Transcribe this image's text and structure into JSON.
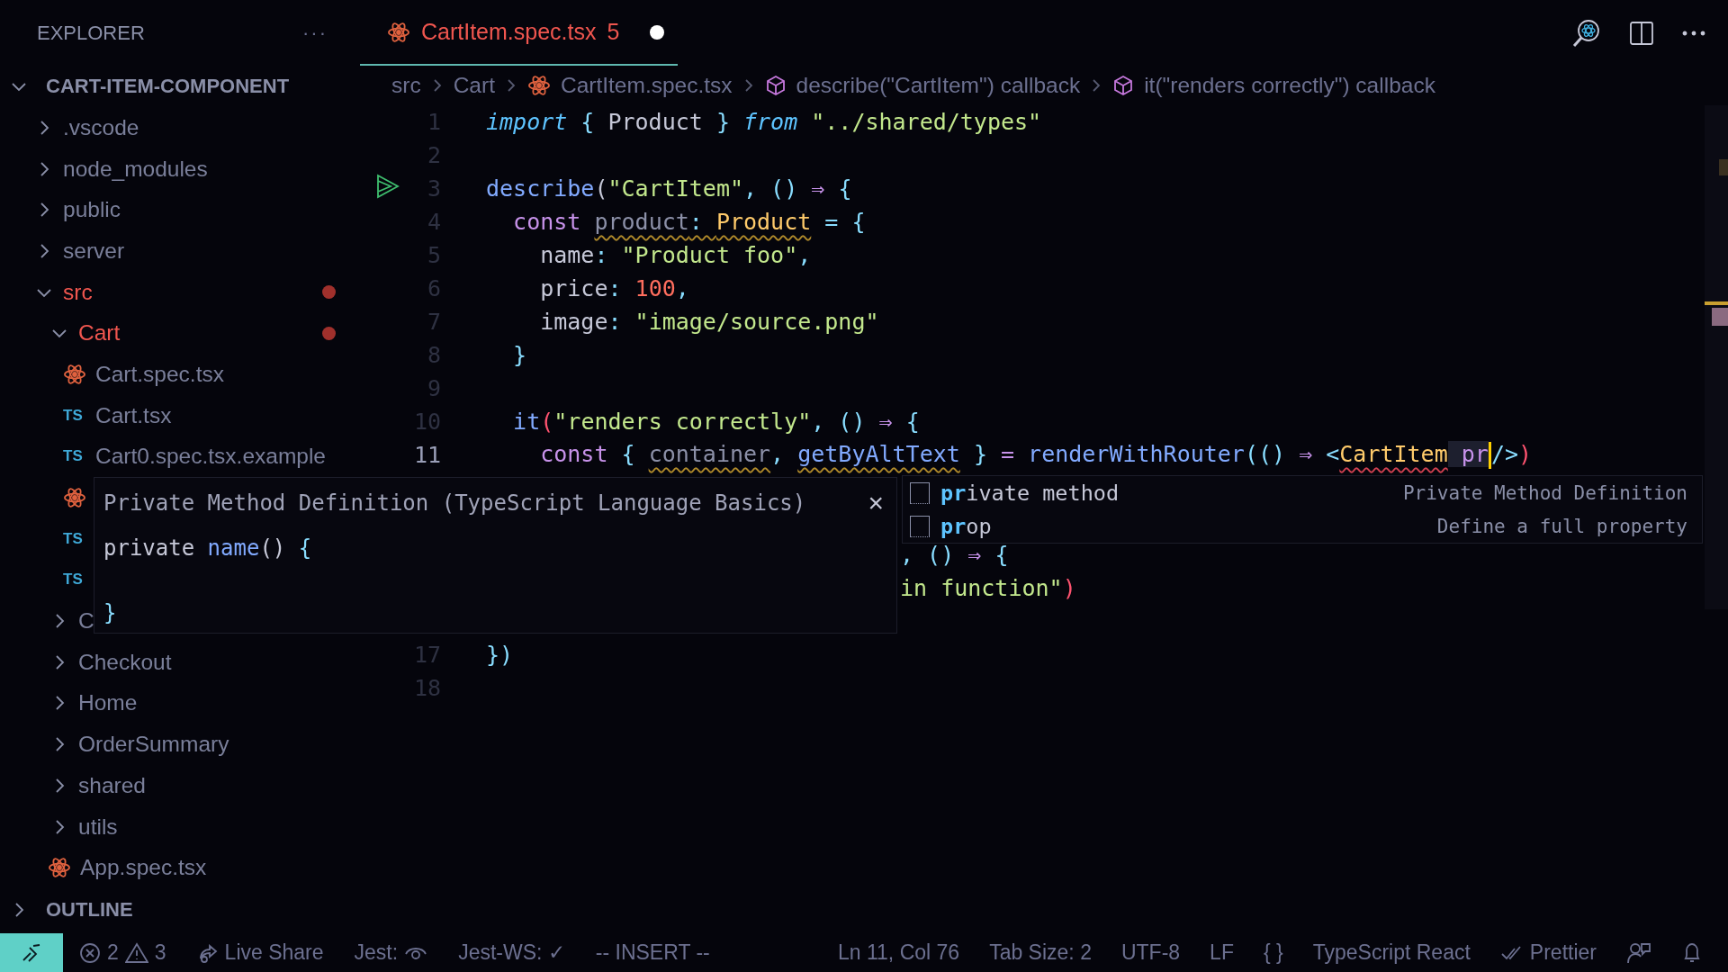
{
  "sidebar": {
    "title": "EXPLORER",
    "more": "···",
    "project": {
      "label": "CART-ITEM-COMPONENT",
      "expanded": true
    },
    "items": [
      {
        "kind": "folder",
        "label": ".vscode",
        "expanded": false,
        "modified": false
      },
      {
        "kind": "folder",
        "label": "node_modules",
        "expanded": false,
        "modified": false
      },
      {
        "kind": "folder",
        "label": "public",
        "expanded": false,
        "modified": false
      },
      {
        "kind": "folder",
        "label": "server",
        "expanded": false,
        "modified": false
      },
      {
        "kind": "folder",
        "label": "src",
        "expanded": true,
        "modified": true,
        "children": [
          {
            "kind": "folder",
            "label": "Cart",
            "expanded": true,
            "modified": true,
            "children": [
              {
                "kind": "react-file",
                "label": "Cart.spec.tsx"
              },
              {
                "kind": "ts-file",
                "badge": "TS",
                "label": "Cart.tsx"
              },
              {
                "kind": "ts-file",
                "badge": "TS",
                "label": "Cart0.spec.tsx.example"
              },
              {
                "kind": "react-file"
              },
              {
                "kind": "ts-file",
                "badge": "TS"
              },
              {
                "kind": "ts-file",
                "badge": "TS"
              }
            ]
          },
          {
            "kind": "folder",
            "label": "C",
            "expanded": false,
            "modified": false
          },
          {
            "kind": "folder",
            "label": "Checkout",
            "expanded": false,
            "modified": false
          },
          {
            "kind": "folder",
            "label": "Home",
            "expanded": false,
            "modified": false
          },
          {
            "kind": "folder",
            "label": "OrderSummary",
            "expanded": false,
            "modified": false
          },
          {
            "kind": "folder",
            "label": "shared",
            "expanded": false,
            "modified": false
          },
          {
            "kind": "folder",
            "label": "utils",
            "expanded": false,
            "modified": false
          },
          {
            "kind": "react-file",
            "label": "App.spec.tsx"
          }
        ]
      }
    ],
    "outline": {
      "label": "OUTLINE",
      "expanded": false
    }
  },
  "tabs": [
    {
      "label": "CartItem.spec.tsx",
      "problems": "5",
      "dirty": true,
      "selected": true
    }
  ],
  "breadcrumb": [
    {
      "kind": "folder",
      "label": "src"
    },
    {
      "kind": "folder",
      "label": "Cart"
    },
    {
      "kind": "react-file",
      "label": "CartItem.spec.tsx"
    },
    {
      "kind": "symbol",
      "label": "describe(\"CartItem\") callback"
    },
    {
      "kind": "symbol",
      "label": "it(\"renders correctly\") callback"
    }
  ],
  "code": [
    {
      "kind": "code",
      "number": "1",
      "run": false,
      "current": false,
      "tokens": [
        {
          "text": "import",
          "kind": "import"
        },
        {
          "text": " { ",
          "kind": "punctuation"
        },
        {
          "text": "Product",
          "kind": "identifier"
        },
        {
          "text": " } ",
          "kind": "punctuation"
        },
        {
          "text": "from",
          "kind": "import"
        },
        {
          "text": " \"../shared/types\"",
          "kind": "string"
        }
      ]
    },
    {
      "kind": "code",
      "number": "2",
      "run": false,
      "current": false
    },
    {
      "kind": "code",
      "number": "3",
      "run": true,
      "current": false,
      "tokens": [
        {
          "text": "describe",
          "kind": "function"
        },
        {
          "text": "(",
          "kind": "identifier"
        },
        {
          "text": "\"CartItem\"",
          "kind": "string"
        },
        {
          "text": ", () ",
          "kind": "punctuation"
        },
        {
          "text": "⇒",
          "kind": "operator"
        },
        {
          "text": " {",
          "kind": "punctuation"
        }
      ]
    },
    {
      "kind": "code",
      "number": "4",
      "run": false,
      "current": false,
      "tokens": [
        {
          "text": "  const ",
          "kind": "keyword"
        },
        {
          "text": "product",
          "kind": "variable",
          "warning": true
        },
        {
          "text": ": ",
          "kind": "punctuation",
          "warning": true
        },
        {
          "text": "Product",
          "kind": "type",
          "warning": true
        },
        {
          "text": " = {",
          "kind": "punctuation"
        }
      ]
    },
    {
      "kind": "code",
      "number": "5",
      "run": false,
      "current": false,
      "tokens": [
        {
          "text": "    name",
          "kind": "property"
        },
        {
          "text": ": ",
          "kind": "punctuation"
        },
        {
          "text": "\"Product foo\"",
          "kind": "string"
        },
        {
          "text": ",",
          "kind": "punctuation"
        }
      ]
    },
    {
      "kind": "code",
      "number": "6",
      "run": false,
      "current": false,
      "tokens": [
        {
          "text": "    price",
          "kind": "property"
        },
        {
          "text": ": ",
          "kind": "punctuation"
        },
        {
          "text": "100",
          "kind": "number"
        },
        {
          "text": ",",
          "kind": "punctuation"
        }
      ]
    },
    {
      "kind": "code",
      "number": "7",
      "run": false,
      "current": false,
      "tokens": [
        {
          "text": "    image",
          "kind": "property"
        },
        {
          "text": ": ",
          "kind": "punctuation"
        },
        {
          "text": "\"image/source.png\"",
          "kind": "string"
        }
      ]
    },
    {
      "kind": "code",
      "number": "8",
      "run": false,
      "current": false,
      "tokens": [
        {
          "text": "  }",
          "kind": "punctuation"
        }
      ]
    },
    {
      "kind": "code",
      "number": "9",
      "run": false,
      "current": false
    },
    {
      "kind": "code",
      "number": "10",
      "run": false,
      "current": false,
      "tokens": [
        {
          "text": "  it",
          "kind": "function"
        },
        {
          "text": "(",
          "kind": "bracket"
        },
        {
          "text": "\"renders correctly\"",
          "kind": "string"
        },
        {
          "text": ", () ",
          "kind": "punctuation"
        },
        {
          "text": "⇒",
          "kind": "operator"
        },
        {
          "text": " {",
          "kind": "punctuation"
        }
      ]
    },
    {
      "kind": "code",
      "number": "11",
      "run": false,
      "current": true,
      "tokens": [
        {
          "text": "    const",
          "kind": "keyword"
        },
        {
          "text": " { ",
          "kind": "punctuation"
        },
        {
          "text": "container",
          "kind": "variable",
          "warning": true
        },
        {
          "text": ", ",
          "kind": "punctuation"
        },
        {
          "text": "getByAltText",
          "kind": "function",
          "warning": true
        },
        {
          "text": " } ",
          "kind": "punctuation"
        },
        {
          "text": "= ",
          "kind": "operator"
        },
        {
          "text": "renderWithRouter",
          "kind": "function"
        },
        {
          "text": "(() ",
          "kind": "punctuation"
        },
        {
          "text": "⇒",
          "kind": "operator"
        },
        {
          "text": " <",
          "kind": "punctuation"
        },
        {
          "text": "CartItem",
          "kind": "type",
          "error": true
        },
        {
          "text": " pr",
          "kind": "attribute",
          "cursor": true
        },
        {
          "text": "/>",
          "kind": "punctuation"
        },
        {
          "text": ")",
          "kind": "bracket"
        }
      ]
    },
    {
      "kind": "hidden"
    },
    {
      "kind": "hidden"
    },
    {
      "kind": "partial",
      "tokens": [
        {
          "text": ", () ",
          "kind": "punctuation"
        },
        {
          "text": "⇒",
          "kind": "operator"
        },
        {
          "text": " {",
          "kind": "punctuation"
        }
      ]
    },
    {
      "kind": "partial",
      "tokens": [
        {
          "text": "in function\"",
          "kind": "string"
        },
        {
          "text": ")",
          "kind": "bracket"
        }
      ]
    },
    {
      "kind": "hidden"
    },
    {
      "kind": "code",
      "number": "17",
      "run": false,
      "current": false,
      "tokens": [
        {
          "text": "})",
          "kind": "punctuation"
        }
      ]
    },
    {
      "kind": "code",
      "number": "18",
      "run": false,
      "current": false
    }
  ],
  "suggest": [
    {
      "label": "**pr**ivate method",
      "detail": "Private Method Definition"
    },
    {
      "label": "**pr**op",
      "detail": "Define a full property"
    }
  ],
  "details": {
    "title": "Private Method Definition (TypeScript Language Basics)",
    "close": "×",
    "lines": [
      {
        "kind": "code",
        "tokens": [
          {
            "text": "private ",
            "kind": "identifier"
          },
          {
            "text": "name",
            "kind": "function"
          },
          {
            "text": "() ",
            "kind": "identifier"
          },
          {
            "text": "{",
            "kind": "punctuation"
          }
        ]
      },
      {
        "kind": "blank"
      },
      {
        "kind": "code",
        "tokens": [
          {
            "text": "}",
            "kind": "punctuation"
          }
        ]
      }
    ]
  },
  "status": {
    "left": [
      {
        "kind": "remote"
      },
      {
        "kind": "problems",
        "errors": "2",
        "warnings": "3"
      },
      {
        "kind": "live-share",
        "text": "Live Share"
      },
      {
        "kind": "jest",
        "text": "Jest:"
      },
      {
        "kind": "text",
        "text": "Jest-WS: ✓"
      },
      {
        "kind": "text",
        "text": "-- INSERT --"
      }
    ],
    "right": [
      {
        "kind": "text",
        "text": "Ln 11, Col 76"
      },
      {
        "kind": "text",
        "text": "Tab Size: 2"
      },
      {
        "kind": "text",
        "text": "UTF-8"
      },
      {
        "kind": "text",
        "text": "LF"
      },
      {
        "kind": "text",
        "text": "{ }"
      },
      {
        "kind": "text",
        "text": "TypeScript React"
      },
      {
        "kind": "prettier",
        "text": "Prettier"
      },
      {
        "kind": "feedback"
      },
      {
        "kind": "bell"
      }
    ]
  }
}
